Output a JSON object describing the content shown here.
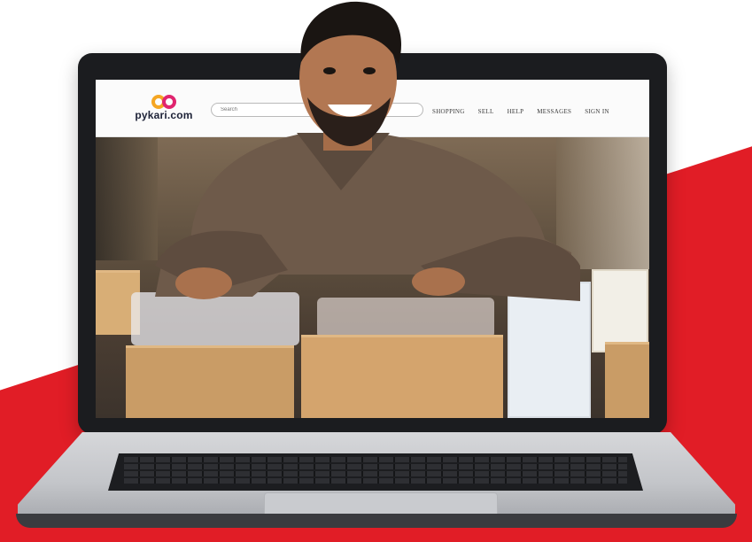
{
  "site": {
    "logo_text": "pykari.com",
    "search": {
      "placeholder": "Search",
      "value": ""
    },
    "nav": [
      "SHOPPING",
      "SELL",
      "HELP",
      "MESSAGES",
      "SIGN IN"
    ]
  },
  "colors": {
    "brand_red": "#e11d26",
    "logo_orange": "#f5a623",
    "logo_magenta": "#e0256f",
    "laptop_bezel": "#1b1c1f"
  },
  "icons": [
    "pykari-logo-icon"
  ]
}
